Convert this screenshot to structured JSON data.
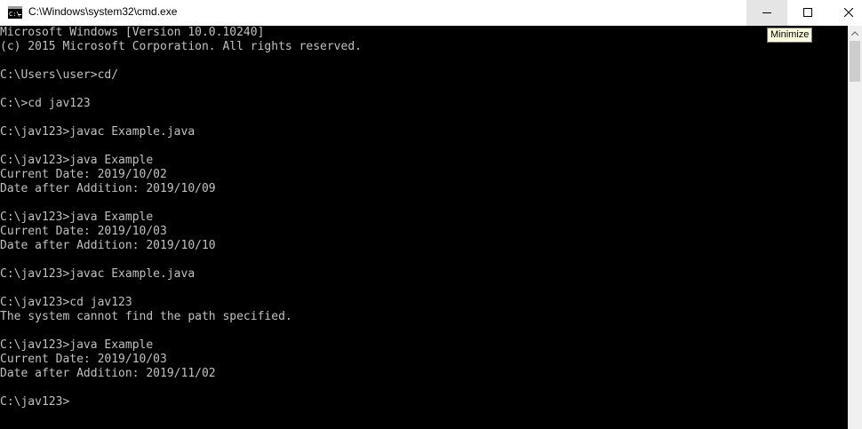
{
  "window": {
    "title": "C:\\Windows\\system32\\cmd.exe",
    "icon": "cmd-icon",
    "controls": {
      "minimize_icon": "minimize-icon",
      "maximize_icon": "maximize-icon",
      "close_icon": "close-icon"
    },
    "tooltip": "Minimize"
  },
  "console": {
    "lines": [
      "Microsoft Windows [Version 10.0.10240]",
      "(c) 2015 Microsoft Corporation. All rights reserved.",
      "",
      "C:\\Users\\user>cd/",
      "",
      "C:\\>cd jav123",
      "",
      "C:\\jav123>javac Example.java",
      "",
      "C:\\jav123>java Example",
      "Current Date: 2019/10/02",
      "Date after Addition: 2019/10/09",
      "",
      "C:\\jav123>java Example",
      "Current Date: 2019/10/03",
      "Date after Addition: 2019/10/10",
      "",
      "C:\\jav123>javac Example.java",
      "",
      "C:\\jav123>cd jav123",
      "The system cannot find the path specified.",
      "",
      "C:\\jav123>java Example",
      "Current Date: 2019/10/03",
      "Date after Addition: 2019/11/02",
      "",
      "C:\\jav123>"
    ]
  },
  "colors": {
    "console_background": "#000000",
    "console_text": "#c0c0c0",
    "titlebar": "#ffffff",
    "minimize_hover": "#e5e5e5"
  }
}
